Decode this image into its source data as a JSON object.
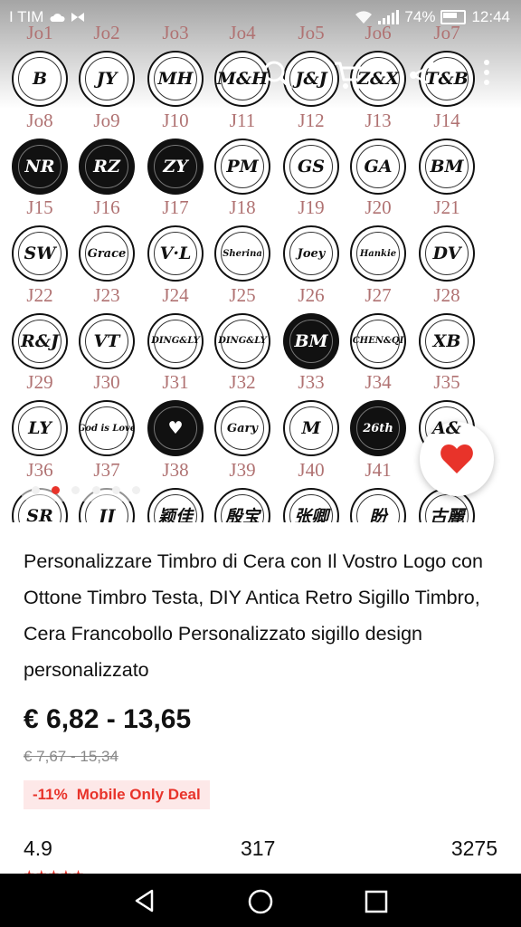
{
  "status_bar": {
    "carrier": "I TIM",
    "battery": "74%",
    "time": "12:44"
  },
  "gallery": {
    "rows": [
      {
        "labels": [
          "Jo1",
          "Jo2",
          "Jo3",
          "Jo4",
          "Jo5",
          "Jo6",
          "Jo7"
        ],
        "stamps": [
          "B",
          "JY",
          "MH",
          "M&H",
          "J&J",
          "Z&X",
          "T&B"
        ]
      },
      {
        "labels": [
          "Jo8",
          "Jo9",
          "J10",
          "J11",
          "J12",
          "J13",
          "J14"
        ],
        "stamps": [
          "NR",
          "RZ",
          "ZY",
          "PM",
          "GS",
          "GA",
          "BM"
        ]
      },
      {
        "labels": [
          "J15",
          "J16",
          "J17",
          "J18",
          "J19",
          "J20",
          "J21"
        ],
        "stamps": [
          "SW",
          "Grace",
          "V·L",
          "Sherina",
          "Joey",
          "Hankie",
          "DV"
        ]
      },
      {
        "labels": [
          "J22",
          "J23",
          "J24",
          "J25",
          "J26",
          "J27",
          "J28"
        ],
        "stamps": [
          "R&J",
          "VT",
          "DING&LY",
          "DING&LY",
          "BM",
          "CHEN&QI",
          "XB"
        ]
      },
      {
        "labels": [
          "J29",
          "J30",
          "J31",
          "J32",
          "J33",
          "J34",
          "J35"
        ],
        "stamps": [
          "LY",
          "God is Love",
          "♥",
          "Gary",
          "M",
          "26th",
          "A&"
        ]
      },
      {
        "labels": [
          "J36",
          "J37",
          "J38",
          "J39",
          "J40",
          "J41",
          ""
        ],
        "stamps": [
          "SR",
          "JJ",
          "颖佳",
          "殷宝",
          "张卿",
          "盼",
          "古麗"
        ]
      }
    ],
    "carousel": {
      "count": 6,
      "active_index": 1
    }
  },
  "product": {
    "title": "Personalizzare Timbro di Cera con Il Vostro Logo con Ottone Timbro Testa, DIY Antica Retro Sigillo Timbro, Cera Francobollo Personalizzato sigillo design personalizzato",
    "price_range": "€ 6,82 - 13,65",
    "original_price": "€ 7,67 - 15,34",
    "discount": "-11%",
    "deal_label": "Mobile Only Deal",
    "rating": "4.9",
    "reviews_count": "317",
    "orders_count": "3275"
  },
  "colors": {
    "accent": "#e8332a",
    "label": "#b07272"
  },
  "icons": {
    "search": "search-icon",
    "cart": "cart-icon",
    "share": "share-icon",
    "more": "more-vertical-icon",
    "favorite": "heart-icon",
    "back": "back-icon",
    "home": "home-icon",
    "recents": "recents-icon"
  }
}
